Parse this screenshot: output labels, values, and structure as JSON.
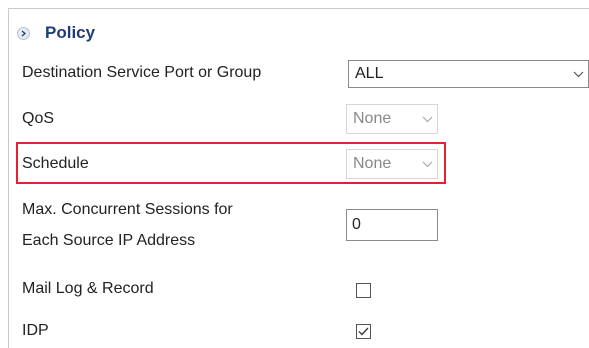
{
  "section": {
    "title": "Policy",
    "icon": "circle-arrow-right-icon"
  },
  "fields": {
    "destination": {
      "label": "Destination Service Port or Group",
      "value": "ALL"
    },
    "qos": {
      "label": "QoS",
      "value": "None"
    },
    "schedule": {
      "label": "Schedule",
      "value": "None"
    },
    "max_sessions": {
      "label_line1": "Max. Concurrent Sessions for",
      "label_line2": "Each Source IP Address",
      "value": "0"
    },
    "mail_log": {
      "label": "Mail Log & Record",
      "checked": false
    },
    "idp": {
      "label": "IDP",
      "checked": true
    }
  },
  "colors": {
    "highlight": "#e0232e",
    "section_title": "#1f3d7a"
  }
}
